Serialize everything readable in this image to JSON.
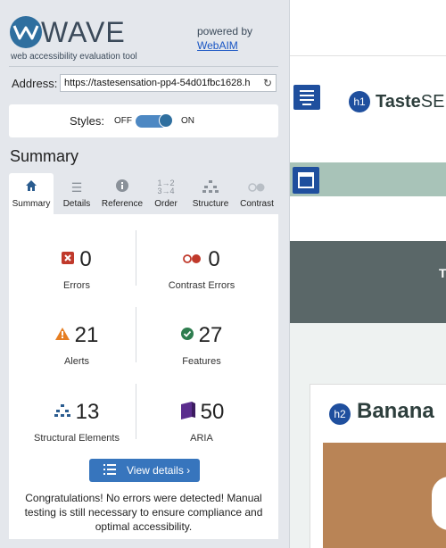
{
  "app": {
    "title": "WAVE",
    "subtitle": "web accessibility evaluation tool",
    "powered_by": "powered by",
    "powered_link": "WebAIM"
  },
  "address": {
    "label": "Address:",
    "value": "https://tastesensation-pp4-54d01fbc1628.h"
  },
  "styles": {
    "label": "Styles:",
    "off_label": "OFF",
    "on_label": "ON",
    "enabled": true
  },
  "summary_heading": "Summary",
  "tabs": [
    {
      "label": "Summary",
      "icon": "home-icon",
      "active": true
    },
    {
      "label": "Details",
      "icon": "list-icon",
      "active": false
    },
    {
      "label": "Reference",
      "icon": "info-icon",
      "active": false
    },
    {
      "label": "Order",
      "icon": "order-icon",
      "active": false
    },
    {
      "label": "Structure",
      "icon": "structure-icon",
      "active": false
    },
    {
      "label": "Contrast",
      "icon": "contrast-icon",
      "active": false
    }
  ],
  "stats": {
    "errors": {
      "count": "0",
      "label": "Errors",
      "icon": "error-icon",
      "color": "#c0392b"
    },
    "contrast_errors": {
      "count": "0",
      "label": "Contrast Errors",
      "icon": "contrast-error-icon",
      "color": "#c0392b"
    },
    "alerts": {
      "count": "21",
      "label": "Alerts",
      "icon": "alert-icon",
      "color": "#e67e22"
    },
    "features": {
      "count": "27",
      "label": "Features",
      "icon": "check-icon",
      "color": "#2e7d4f"
    },
    "structural": {
      "count": "13",
      "label": "Structural Elements",
      "icon": "structure-icon",
      "color": "#2b5c8f"
    },
    "aria": {
      "count": "50",
      "label": "ARIA",
      "icon": "aria-icon",
      "color": "#5b2d8e"
    }
  },
  "view_details": "View details ›",
  "message": "Congratulations! No errors were detected! Manual testing is still necessary to ensure compliance and optimal accessibility.",
  "page": {
    "h1_badge": "h1",
    "brand_part1": "Taste",
    "brand_part2": "SEN",
    "h2_badge": "h2",
    "card_title": "Banana",
    "band_letter": "T"
  },
  "colors": {
    "accent": "#3775bd",
    "sidebar_bg": "#e4e7ec",
    "badge_blue": "#1f4f9e"
  }
}
